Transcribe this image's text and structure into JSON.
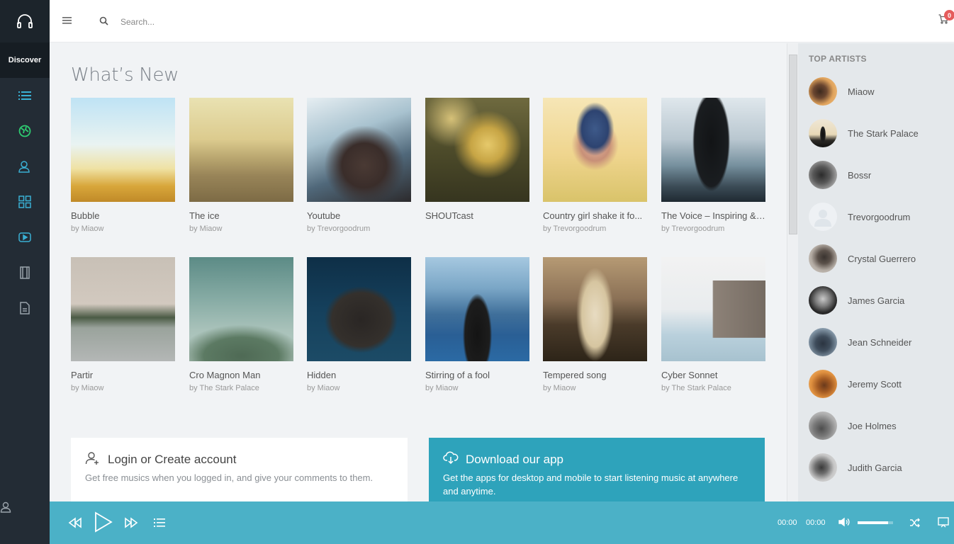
{
  "sidebar": {
    "discover_label": "Discover",
    "nav_icons": [
      "list-icon",
      "globe-icon",
      "users-icon",
      "grid-icon",
      "video-icon",
      "film-icon",
      "file-icon"
    ]
  },
  "search": {
    "placeholder": "Search..."
  },
  "cart": {
    "count": "0"
  },
  "main": {
    "heading": "What’s New",
    "albums": [
      {
        "title": "Bubble",
        "artist": "by Miaow"
      },
      {
        "title": "The ice",
        "artist": "by Miaow"
      },
      {
        "title": "Youtube",
        "artist": "by Trevorgoodrum"
      },
      {
        "title": "SHOUTcast",
        "artist": ""
      },
      {
        "title": "Country girl shake it fo...",
        "artist": "by Trevorgoodrum"
      },
      {
        "title": "The Voice – Inspiring & ...",
        "artist": "by Trevorgoodrum"
      },
      {
        "title": "Partir",
        "artist": "by Miaow"
      },
      {
        "title": "Cro Magnon Man",
        "artist": "by The Stark Palace"
      },
      {
        "title": "Hidden",
        "artist": "by Miaow"
      },
      {
        "title": "Stirring of a fool",
        "artist": "by Miaow"
      },
      {
        "title": "Tempered song",
        "artist": "by Miaow"
      },
      {
        "title": "Cyber Sonnet",
        "artist": "by The Stark Palace"
      }
    ],
    "login_promo": {
      "title": "Login or Create account",
      "desc": "Get free musics when you logged in, and give your comments to them."
    },
    "download_promo": {
      "title": "Download our app",
      "desc": "Get the apps for desktop and mobile to start listening music at anywhere and anytime."
    }
  },
  "top_artists": {
    "heading": "TOP ARTISTS",
    "items": [
      "Miaow",
      "The Stark Palace",
      "Bossr",
      "Trevorgoodrum",
      "Crystal Guerrero",
      "James Garcia",
      "Jean Schneider",
      "Jeremy Scott",
      "Joe Holmes",
      "Judith Garcia"
    ]
  },
  "player": {
    "current_time": "00:00",
    "duration": "00:00",
    "volume": 0.85
  },
  "colors": {
    "sidebar": "#232c35",
    "accent": "#4bb1c7",
    "download_bg": "#2ea3bb",
    "badge": "#e55c5c",
    "active_nav": "#2ecc71"
  }
}
